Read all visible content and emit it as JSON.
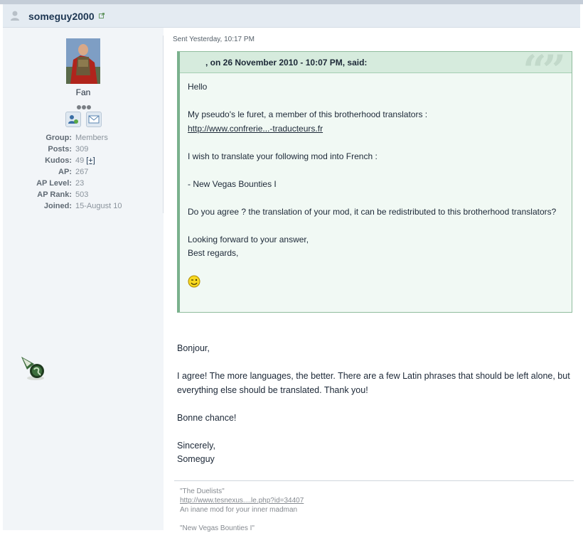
{
  "post": {
    "username": "someguy2000",
    "sent": "Sent Yesterday, 10:17 PM"
  },
  "author": {
    "rank_title": "Fan",
    "stats": [
      {
        "label": "Group:",
        "value": "Members"
      },
      {
        "label": "Posts:",
        "value": "309"
      },
      {
        "label": "Kudos:",
        "value": "49",
        "extra": "[+]"
      },
      {
        "label": "AP:",
        "value": "267"
      },
      {
        "label": "AP Level:",
        "value": "23"
      },
      {
        "label": "AP Rank:",
        "value": "503"
      },
      {
        "label": "Joined:",
        "value": "15-August 10"
      }
    ]
  },
  "quote": {
    "citation": ", on 26 November 2010 - 10:07 PM, said:",
    "greeting": "Hello",
    "line1": "My pseudo's le furet, a member of this brotherhood translators :",
    "link": "http://www.confrerie...-traducteurs.fr",
    "line2": "I wish to translate your following mod into French :",
    "line3": "- New Vegas Bounties I",
    "line4": "Do you agree ? the translation of your mod, it can be redistributed to this brotherhood translators?",
    "line5": "Looking forward to your answer,",
    "line6": "Best regards,"
  },
  "reply": {
    "p1": "Bonjour,",
    "p2": "I agree! The more languages, the better. There are a few Latin phrases that should be left alone, but everything else should be translated. Thank you!",
    "p3": "Bonne chance!",
    "p4a": "Sincerely,",
    "p4b": "Someguy"
  },
  "signature": {
    "title1": "\"The Duelists\"",
    "link1": "http://www.tesnexus....le.php?id=34407",
    "desc1": "An inane mod for your inner madman",
    "title2": "\"New Vegas Bounties I\""
  },
  "icons": {
    "user": "user-silhouette-icon",
    "external": "external-link-icon",
    "profile": "profile-card-icon",
    "message": "envelope-icon",
    "smiley": "wink-smiley-icon",
    "badge": "premium-badge-icon"
  },
  "colors": {
    "header_bg": "#e4ebf2",
    "sidebar_bg": "#f2f5f8",
    "quote_bg": "#f1f9f4",
    "quote_border": "#7ab18d",
    "username": "#1d3652"
  }
}
